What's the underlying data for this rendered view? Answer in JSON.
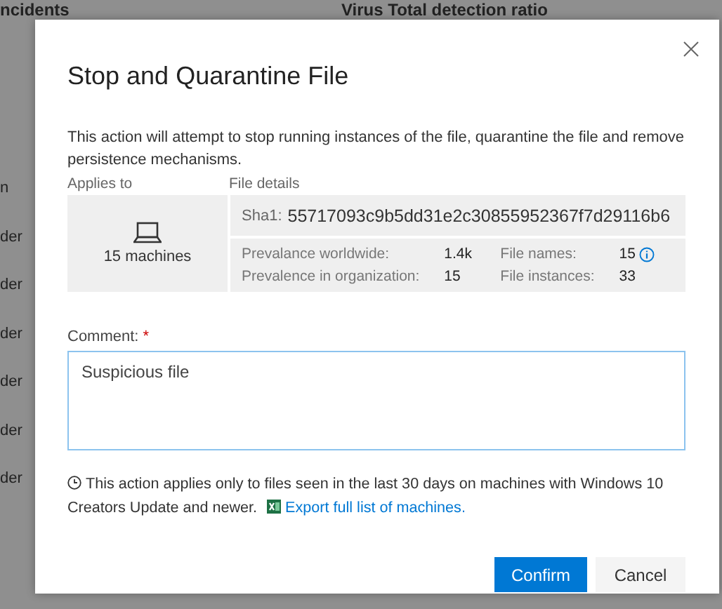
{
  "background": {
    "headers": [
      "ncidents",
      "Virus Total detection ratio"
    ],
    "row_labels": [
      "n",
      "der",
      "der",
      "der",
      "der",
      "der",
      "der"
    ]
  },
  "dialog": {
    "title": "Stop and Quarantine File",
    "description": "This action will attempt to stop running instances of the file, quarantine the file and remove persistence mechanisms.",
    "applies_to": {
      "label": "Applies to",
      "value": "15 machines"
    },
    "file_details": {
      "label": "File details",
      "sha_label": "Sha1:",
      "sha_value": "55717093c9b5dd31e2c30855952367f7d29116b6",
      "stats": [
        {
          "label": "Prevalance worldwide:",
          "value": "1.4k",
          "info": false
        },
        {
          "label": "File names:",
          "value": "15",
          "info": true
        },
        {
          "label": "Prevalence in organization:",
          "value": "15",
          "info": false
        },
        {
          "label": "File instances:",
          "value": "33",
          "info": false
        }
      ]
    },
    "comment": {
      "label": "Comment:",
      "required_mark": "*",
      "value": "Suspicious file"
    },
    "note": {
      "text": "This action applies only to files seen in the last 30 days on machines with Windows 10 Creators Update and newer.",
      "link": "Export full list of machines."
    },
    "buttons": [
      {
        "label": "Confirm",
        "kind": "primary"
      },
      {
        "label": "Cancel",
        "kind": "secondary"
      }
    ]
  }
}
